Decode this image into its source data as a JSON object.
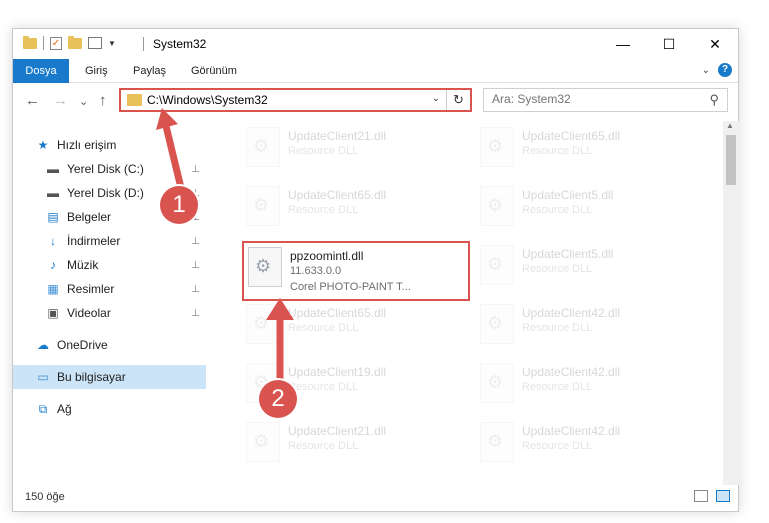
{
  "window": {
    "title": "System32"
  },
  "window_controls": {
    "minimize": "—",
    "maximize": "☐",
    "close": "✕"
  },
  "ribbon": {
    "tabs": [
      "Dosya",
      "Giriş",
      "Paylaş",
      "Görünüm"
    ],
    "collapse": "⌄",
    "help": "?"
  },
  "nav": {
    "back": "←",
    "forward": "→",
    "recent": "⌄",
    "up": "↑",
    "address": "C:\\Windows\\System32",
    "address_dropdown": "⌄",
    "refresh": "↻",
    "search_placeholder": "Ara: System32",
    "search_icon": "⚲"
  },
  "sidebar": {
    "items": [
      {
        "label": "Hızlı erişim",
        "icon": "star-icon",
        "glyph": "★",
        "pinned": false
      },
      {
        "label": "Yerel Disk (C:)",
        "icon": "drive-icon",
        "glyph": "▬",
        "pinned": true
      },
      {
        "label": "Yerel Disk (D:)",
        "icon": "drive-icon",
        "glyph": "▬",
        "pinned": true
      },
      {
        "label": "Belgeler",
        "icon": "document-icon",
        "glyph": "▤",
        "pinned": true
      },
      {
        "label": "İndirmeler",
        "icon": "download-icon",
        "glyph": "↓",
        "pinned": true
      },
      {
        "label": "Müzik",
        "icon": "music-icon",
        "glyph": "♪",
        "pinned": true
      },
      {
        "label": "Resimler",
        "icon": "pictures-icon",
        "glyph": "▦",
        "pinned": true
      },
      {
        "label": "Videolar",
        "icon": "video-icon",
        "glyph": "▣",
        "pinned": true
      },
      {
        "label": "OneDrive",
        "icon": "cloud-icon",
        "glyph": "☁",
        "pinned": false
      },
      {
        "label": "Bu bilgisayar",
        "icon": "computer-icon",
        "glyph": "▭",
        "pinned": false,
        "selected": true
      },
      {
        "label": "Ağ",
        "icon": "network-icon",
        "glyph": "⧉",
        "pinned": false
      }
    ],
    "pin_glyph": "📌"
  },
  "files": [
    {
      "name": "UpdateClient21.dll",
      "line1": "Resource DLL",
      "line2": "",
      "faded": true
    },
    {
      "name": "UpdateClient65.dll",
      "line1": "Resource DLL",
      "line2": "",
      "faded": true
    },
    {
      "name": "UpdateClient65.dll",
      "line1": "Resource DLL",
      "line2": "",
      "faded": true
    },
    {
      "name": "UpdateClient5.dll",
      "line1": "Resource DLL",
      "line2": "",
      "faded": true
    },
    {
      "name": "ppzoomintl.dll",
      "line1": "11.633.0.0",
      "line2": "Corel PHOTO-PAINT T...",
      "faded": false
    },
    {
      "name": "UpdateClient5.dll",
      "line1": "Resource DLL",
      "line2": "",
      "faded": true
    },
    {
      "name": "UpdateClient65.dll",
      "line1": "Resource DLL",
      "line2": "",
      "faded": true
    },
    {
      "name": "UpdateClient42.dll",
      "line1": "Resource DLL",
      "line2": "",
      "faded": true
    },
    {
      "name": "UpdateClient19.dll",
      "line1": "Resource DLL",
      "line2": "",
      "faded": true
    },
    {
      "name": "UpdateClient42.dll",
      "line1": "Resource DLL",
      "line2": "",
      "faded": true
    },
    {
      "name": "UpdateClient21.dll",
      "line1": "Resource DLL",
      "line2": "",
      "faded": true
    },
    {
      "name": "UpdateClient42.dll",
      "line1": "Resource DLL",
      "line2": "",
      "faded": true
    }
  ],
  "status": {
    "count": "150 öğe"
  },
  "annotations": {
    "step1": "1",
    "step2": "2"
  },
  "colors": {
    "accent": "#1979ca",
    "highlight": "#d9534f",
    "selected": "#cce4f7"
  }
}
